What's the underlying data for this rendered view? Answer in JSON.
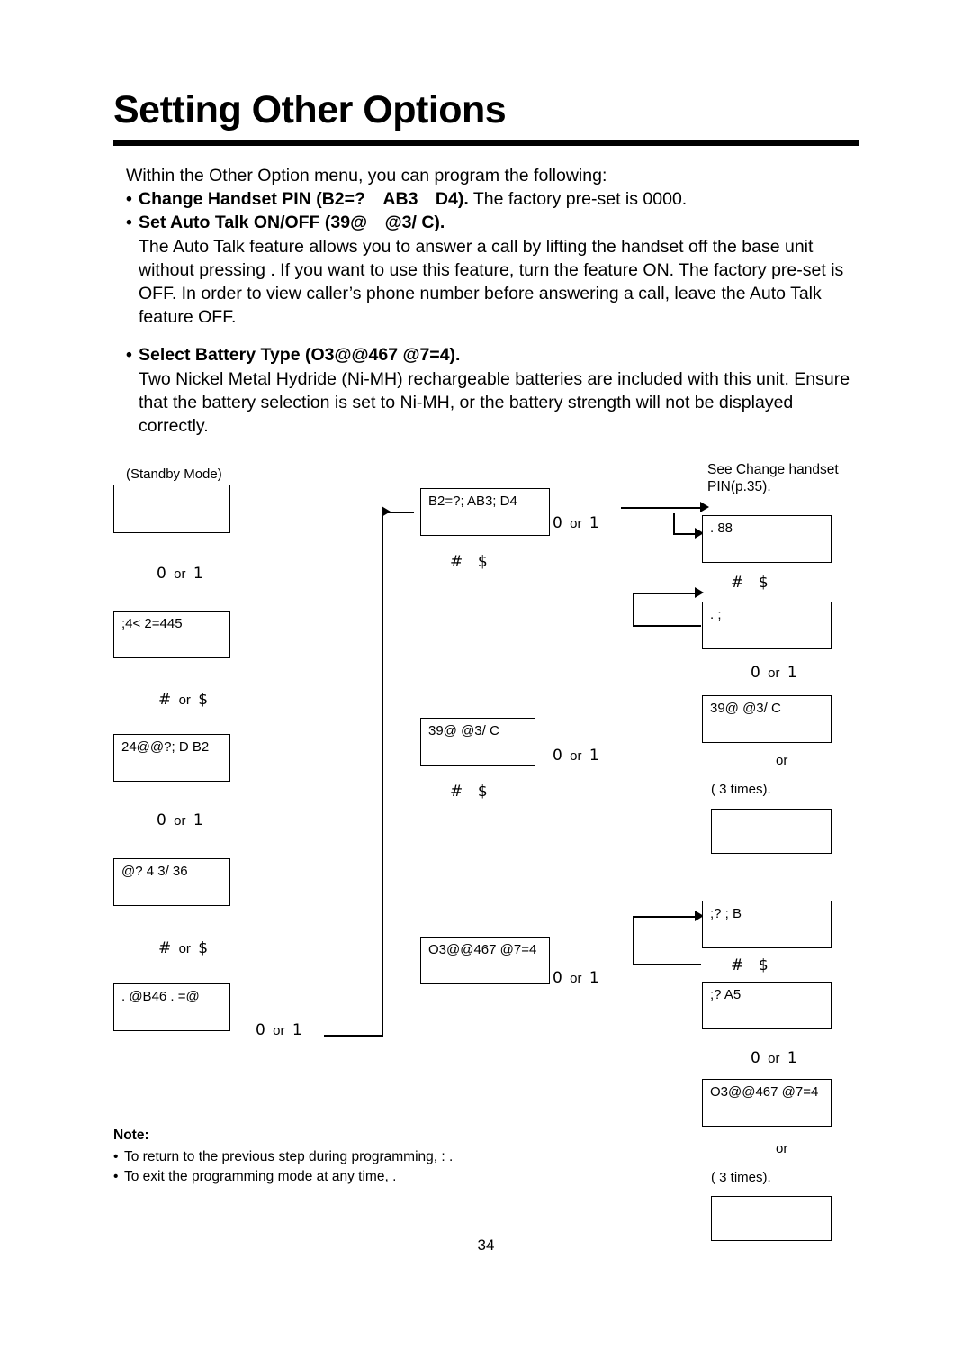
{
  "header": {
    "title": "Setting Other Options"
  },
  "intro": {
    "lead": "Within the Other Option menu, you can program the following:",
    "bullet1_bold": "Change Handset PIN (B2=?　AB3　D4).",
    "bullet1_rest": " The factory pre-set is 0000.",
    "bullet2_bold": "Set Auto Talk ON/OFF (39@　@3/ C).",
    "paragraph1": "The Auto Talk feature allows you to answer a call by lifting the handset off the base unit without pressing     . If you want to use this feature, turn the feature ON. The factory pre-set is OFF. In order to view caller’s phone number before answering a call, leave the Auto Talk feature OFF.",
    "bullet3_bold": "Select Battery Type (O3@@467 @7=4).",
    "paragraph2": "Two Nickel Metal Hydride (Ni-MH) rechargeable batteries are included with this unit. Ensure that the battery selection is set to Ni-MH, or the battery strength will not be displayed correctly."
  },
  "flow": {
    "standby_label": "(Standby Mode)",
    "box_standby": "",
    "label_or_1": "0  or  1",
    "box_program": ";4< 2=445",
    "label_hash_or_dollar_1": "#  or  $",
    "label_hash_or_dollar_2": "#  or  $",
    "box_ringer": "24@@?; D B2",
    "label_or_2": "0  or  1",
    "box_dial": "@? 4 3/ 36",
    "box_other": ". @B46 . =@",
    "label_or_3": "0  or  1",
    "box_pin": "B2=?; AB3; D4",
    "label_hash_dollar_mid1": "#    $",
    "label_or_mid1": "0  or  1",
    "box_autotalk": "39@ @3/ C",
    "label_hash_dollar_mid2": "#    $",
    "label_or_mid2": "0  or  1",
    "box_battery": "O3@@467 @7=4",
    "label_or_mid3": "0  or  1",
    "caption_see_change": "See Change handset PIN(p.35).",
    "box_r1": ". 88",
    "label_r_hash_dollar_1": "#    $",
    "box_r2": ". ;",
    "label_r_or_1": "0  or  1",
    "box_r3": "39@ @3/ C",
    "label_r_or_text": "or",
    "label_r_times": "(        3 times).",
    "box_r_blank1": "",
    "box_r4": ";? ; B",
    "label_r_hash_dollar_2": "#    $",
    "box_r5": ";? A5",
    "label_r_or_2": "0  or  1",
    "box_r6": "O3@@467 @7=4",
    "label_r_or_text2": "or",
    "label_r_times2": "(        3 times).",
    "box_r_blank2": ""
  },
  "note": {
    "title": "Note:",
    "item1": "To return to the previous step during programming,            :  .",
    "item2": "To exit the programming mode at any time,                   ."
  },
  "footer": {
    "page_number": "34"
  }
}
